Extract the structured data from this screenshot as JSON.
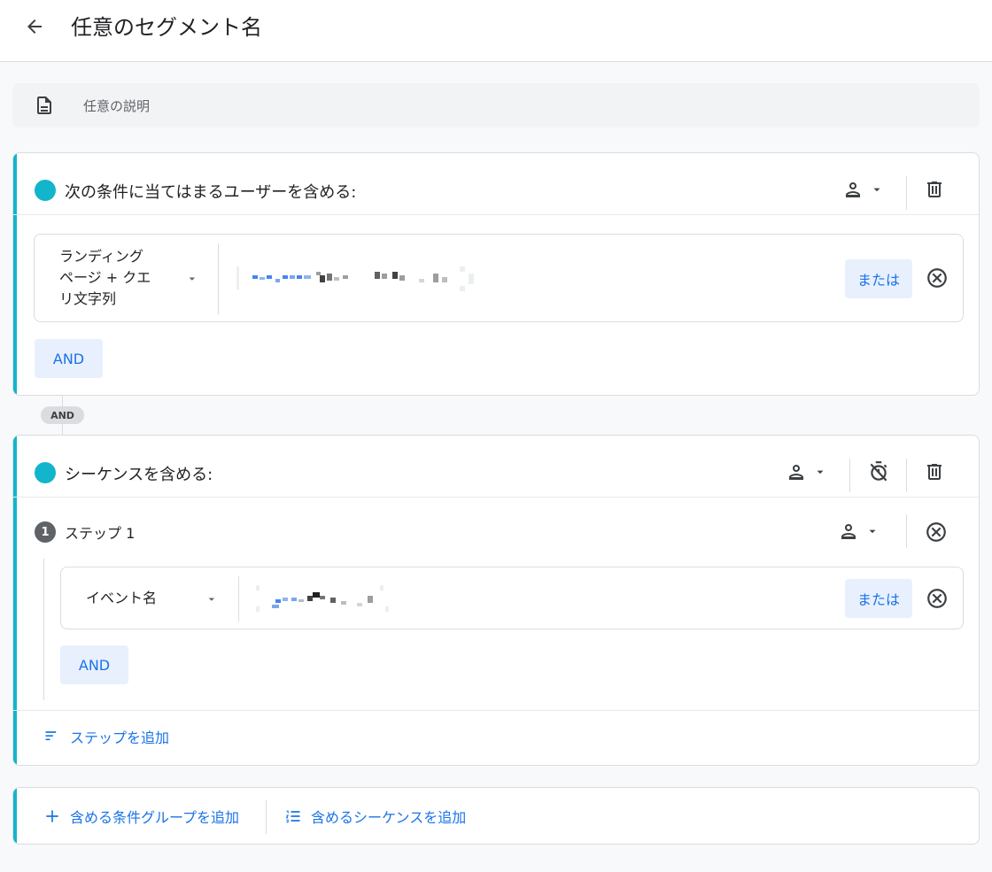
{
  "header": {
    "title": "任意のセグメント名"
  },
  "description": {
    "placeholder": "任意の説明"
  },
  "include_group": {
    "title": "次の条件に当てはまるユーザーを含める:",
    "condition": {
      "dimension": "ランディング ページ + クエリ文字列",
      "dimension_lines": [
        "ランディング",
        "ページ + クエ",
        "リ文字列"
      ],
      "or_label": "または"
    },
    "and_label": "AND"
  },
  "group_connector": {
    "label": "AND"
  },
  "sequence_group": {
    "title": "シーケンスを含める:",
    "step": {
      "number": "1",
      "label": "ステップ 1",
      "condition": {
        "dimension": "イベント名",
        "or_label": "または"
      },
      "and_label": "AND"
    },
    "add_step_label": "ステップを追加"
  },
  "footer": {
    "add_condition_group_label": "含める条件グループを追加",
    "add_sequence_label": "含めるシーケンスを追加"
  },
  "colors": {
    "accent": "#12b5cb",
    "link": "#1a73e8",
    "chip_bg": "#e8f0fe"
  }
}
